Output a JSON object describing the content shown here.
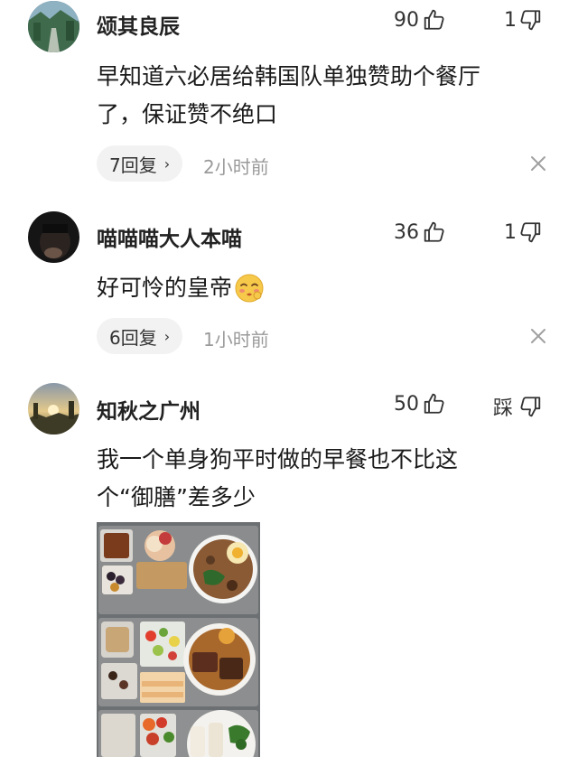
{
  "comments": [
    {
      "username": "颂其良辰",
      "likes": "90",
      "dislikes": "1",
      "lines": [
        "早知道六必居给韩国队单独赞助个餐厅",
        "了，保证赞不绝口"
      ],
      "replies": "7回复",
      "time": "2小时前"
    },
    {
      "username": "喵喵喵大人本喵",
      "likes": "36",
      "dislikes": "1",
      "lines": [
        "好可怜的皇帝"
      ],
      "replies": "6回复",
      "time": "1小时前"
    },
    {
      "username": "知秋之广州",
      "likes": "50",
      "dislikes": "踩",
      "lines": [
        "我一个单身狗平时做的早餐也不比这",
        "个“御膳”差多少"
      ]
    }
  ],
  "icons": {
    "like": "thumbs-up-icon",
    "dislike": "thumbs-down-icon",
    "close": "close-icon",
    "chevron": "chevron-right-icon",
    "emoji": "blushing-face-emoji"
  },
  "colors": {
    "reply_pill_bg": "#f2f2f2",
    "timestamp": "#9a9a9a"
  }
}
